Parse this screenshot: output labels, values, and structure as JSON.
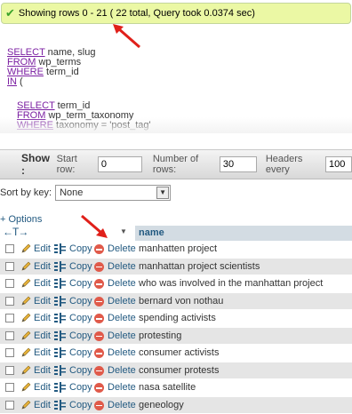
{
  "notice": {
    "text": "Showing rows 0 - 21 ( 22 total, Query took 0.0374 sec)"
  },
  "sql": {
    "lines": [
      {
        "kw": "SELECT",
        "rest": " name, slug"
      },
      {
        "kw": "FROM",
        "rest": " wp_terms"
      },
      {
        "kw": "WHERE",
        "rest": " term_id"
      },
      {
        "kw": "IN",
        "rest": " ("
      },
      {
        "kw": "",
        "rest": ""
      },
      {
        "kw": "SELECT",
        "rest": " term_id"
      },
      {
        "kw": "FROM",
        "rest": " wp_term_taxonomy"
      },
      {
        "kw": "WHERE",
        "rest": " taxonomy = 'post_tag'"
      }
    ]
  },
  "nav": {
    "show_label": "Show :",
    "start_row_label": "Start row:",
    "start_row_value": "0",
    "num_rows_label": "Number of rows:",
    "num_rows_value": "30",
    "headers_every_label": "Headers every",
    "headers_every_value": "100"
  },
  "sort": {
    "label": "Sort by key:",
    "value": "None"
  },
  "options_link": "+ Options",
  "table": {
    "header_arrows": "←T→",
    "column_name": "name",
    "action_labels": {
      "edit": "Edit",
      "copy": "Copy",
      "delete": "Delete"
    },
    "rows": [
      "manhatten project",
      "manhattan project scientists",
      "who was involved in the manhattan project",
      "bernard von nothau",
      "spending activists",
      "protesting",
      "consumer activists",
      "consumer protests",
      "nasa satellite",
      "geneology"
    ]
  },
  "colors": {
    "link": "#235a81",
    "notice_bg": "#ebf8a4",
    "header_bg": "#d3dce3",
    "annotation_arrow": "#e0201a"
  }
}
